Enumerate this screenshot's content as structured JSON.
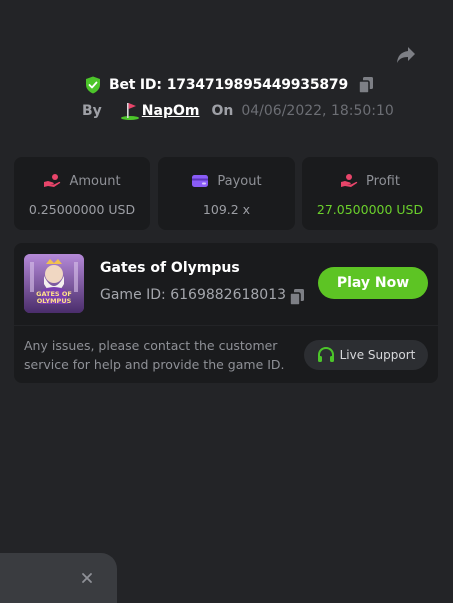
{
  "bet": {
    "id_label": "Bet ID:",
    "id_value": "1734719895449935879"
  },
  "meta": {
    "by_label": "By",
    "username": "NapOm",
    "on_label": "On",
    "timestamp": "04/06/2022, 18:50:10"
  },
  "stats": [
    {
      "label": "Amount",
      "value": "0.25000000 USD",
      "icon": "hand-coins-icon",
      "color": "#e8456a"
    },
    {
      "label": "Payout",
      "value": "109.2 x",
      "icon": "wallet-card-icon",
      "color": "#8a5cf6"
    },
    {
      "label": "Profit",
      "value": "27.0500000 USD",
      "icon": "hand-coins-icon",
      "color": "#e8456a",
      "value_color": "#6bd02c"
    }
  ],
  "game": {
    "title": "Gates of Olympus",
    "id_label": "Game ID:",
    "id_value": "6169882618013",
    "thumb_text_1": "GATES OF",
    "thumb_text_2": "OLYMPUS",
    "play_label": "Play Now"
  },
  "help": {
    "text": "Any issues, please contact the customer service for help and provide the game ID.",
    "support_label": "Live Support"
  },
  "colors": {
    "background": "#232427",
    "card": "#1a1b1d",
    "accent_green": "#5dc424",
    "shield_green": "#4cc52a"
  }
}
